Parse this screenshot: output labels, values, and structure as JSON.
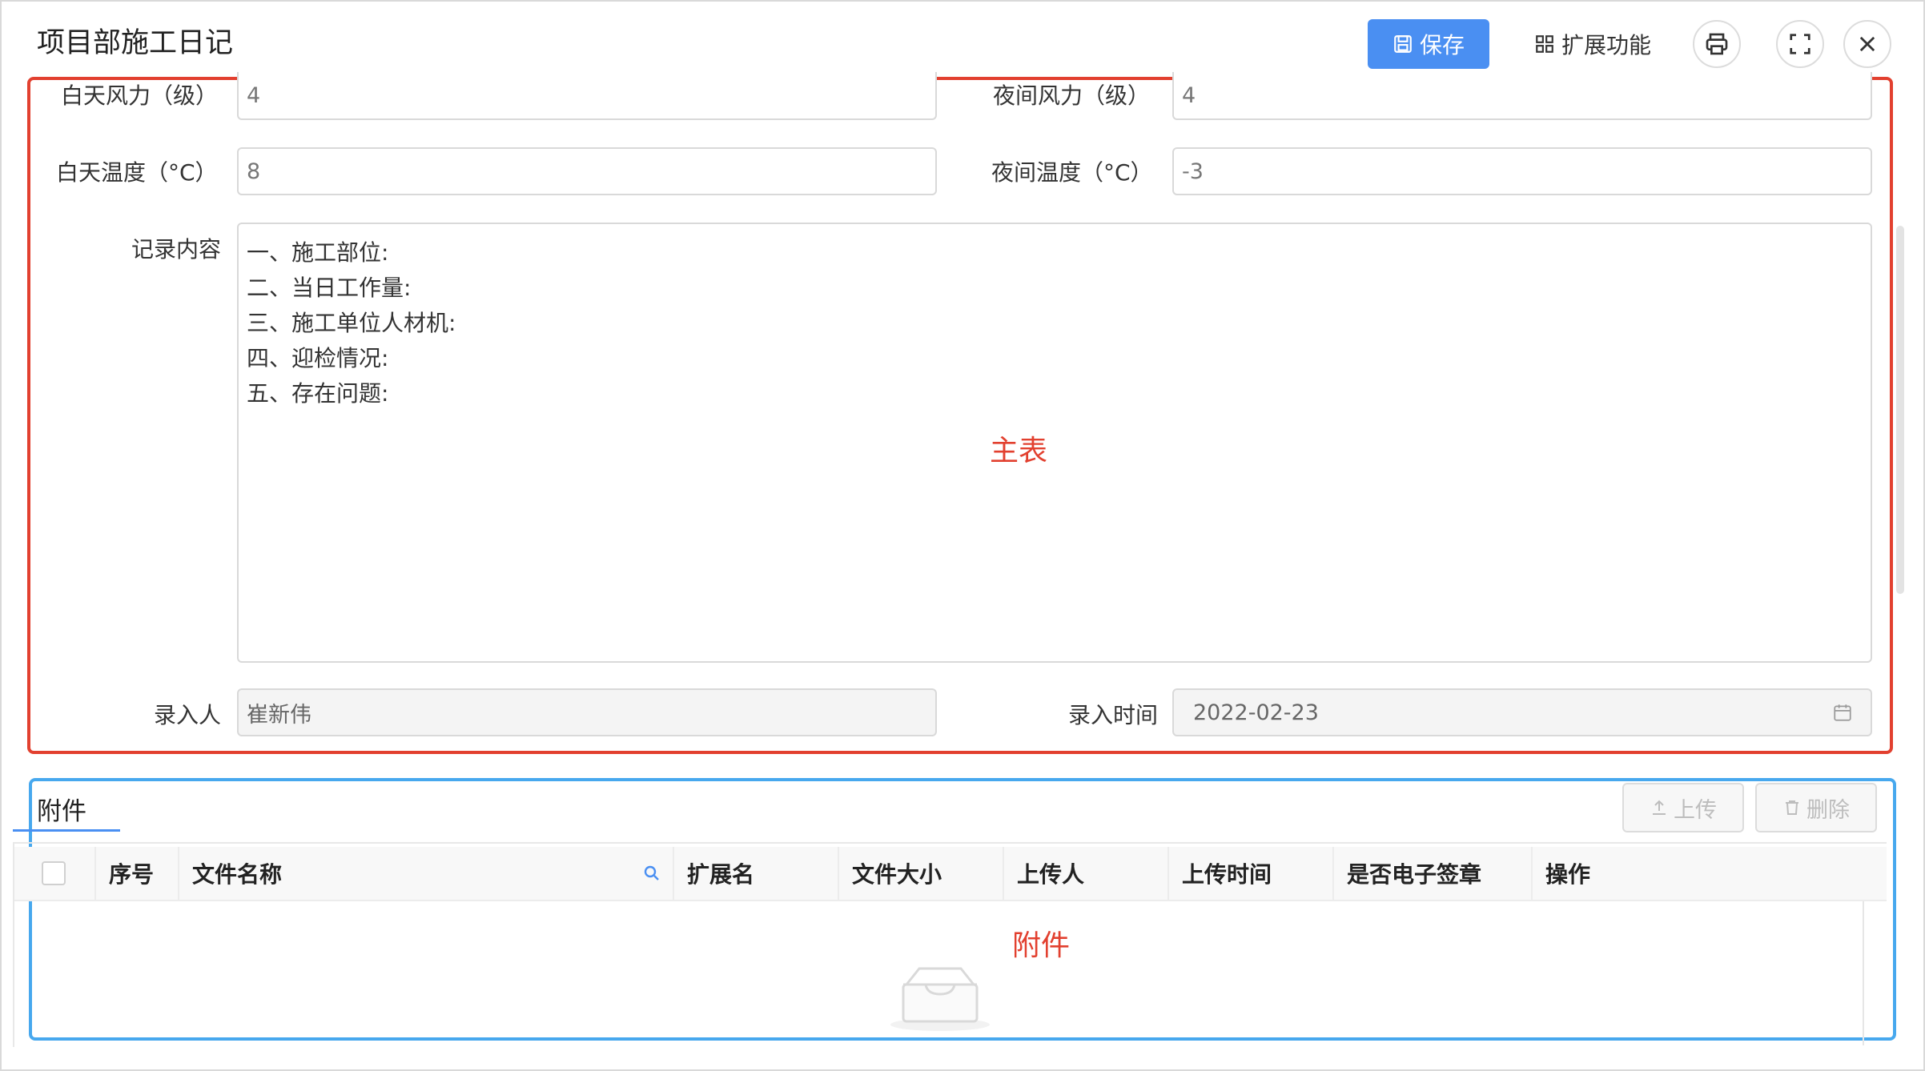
{
  "header": {
    "title": "项目部施工日记",
    "save_label": "保存",
    "ext_label": "扩展功能"
  },
  "main": {
    "day_wind_label": "白天风力（级）",
    "day_wind_value": "4",
    "night_wind_label": "夜间风力（级）",
    "night_wind_value": "4",
    "day_temp_label": "白天温度（°C）",
    "day_temp_value": "8",
    "night_temp_label": "夜间温度（°C）",
    "night_temp_value": "-3",
    "record_label": "记录内容",
    "record_lines": [
      "一、施工部位:",
      "二、当日工作量:",
      "三、施工单位人材机:",
      "四、迎检情况:",
      "五、存在问题:"
    ],
    "recorder_label": "录入人",
    "recorder_value": "崔新伟",
    "record_time_label": "录入时间",
    "record_time_value": "2022-02-23",
    "annotation": "主表"
  },
  "attachments": {
    "tab_label": "附件",
    "upload_label": "上传",
    "delete_label": "删除",
    "columns": [
      "序号",
      "文件名称",
      "扩展名",
      "文件大小",
      "上传人",
      "上传时间",
      "是否电子签章",
      "操作"
    ],
    "annotation": "附件"
  },
  "colors": {
    "primary": "#4a8ff2",
    "annotation_red": "#e2402f",
    "annotation_blue": "#47a8ee"
  }
}
